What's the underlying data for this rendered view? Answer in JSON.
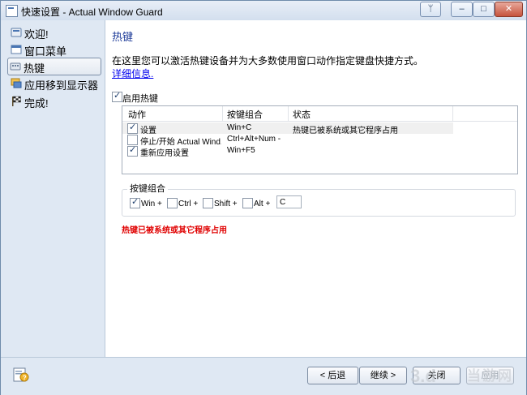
{
  "window": {
    "title": "快速设置 - Actual Window Guard",
    "controls": {
      "pin": "ᛘ",
      "minimize": "–",
      "maximize": "□",
      "close": "✕"
    }
  },
  "nav": {
    "items": [
      {
        "label": "欢迎!",
        "icon": "welcome-icon"
      },
      {
        "label": "窗口菜单",
        "icon": "window-menu-icon"
      },
      {
        "label": "热键",
        "icon": "hotkey-icon",
        "selected": true
      },
      {
        "label": "应用移到显示器",
        "icon": "monitor-icon"
      },
      {
        "label": "完成!",
        "icon": "finish-flag-icon"
      }
    ]
  },
  "content": {
    "heading": "热键",
    "intro": "在这里您可以激活热键设备并为大多数使用窗口动作指定键盘快捷方式。",
    "details_link": "详细信息.",
    "enable_hotkeys": {
      "label": "启用热键",
      "checked": true
    },
    "table": {
      "columns": [
        "动作",
        "按键组合",
        "状态"
      ],
      "rows": [
        {
          "checked": true,
          "action": "设置",
          "keys": "Win+C",
          "status": "热键已被系统或其它程序占用",
          "highlight": true
        },
        {
          "checked": false,
          "action": "停止/开始 Actual Wind...",
          "keys": "Ctrl+Alt+Num -",
          "status": ""
        },
        {
          "checked": true,
          "action": "重新应用设置",
          "keys": "Win+F5",
          "status": ""
        }
      ]
    },
    "key_combo": {
      "title": "按键组合",
      "win": {
        "label": "Win +",
        "checked": true
      },
      "ctrl": {
        "label": "Ctrl +",
        "checked": false
      },
      "shift": {
        "label": "Shift +",
        "checked": false
      },
      "alt": {
        "label": "Alt +",
        "checked": false
      },
      "key_value": "C"
    },
    "error_message": "热键已被系统或其它程序占用"
  },
  "footer": {
    "back": "< 后退",
    "next": "继续 >",
    "close": "关闭",
    "apply": "应用"
  },
  "watermark": {
    "text": "当游网"
  },
  "colors": {
    "heading": "#1f3c99",
    "error": "#e00000",
    "link": "#0000ee",
    "nav_bg": "#dfe8f3"
  }
}
